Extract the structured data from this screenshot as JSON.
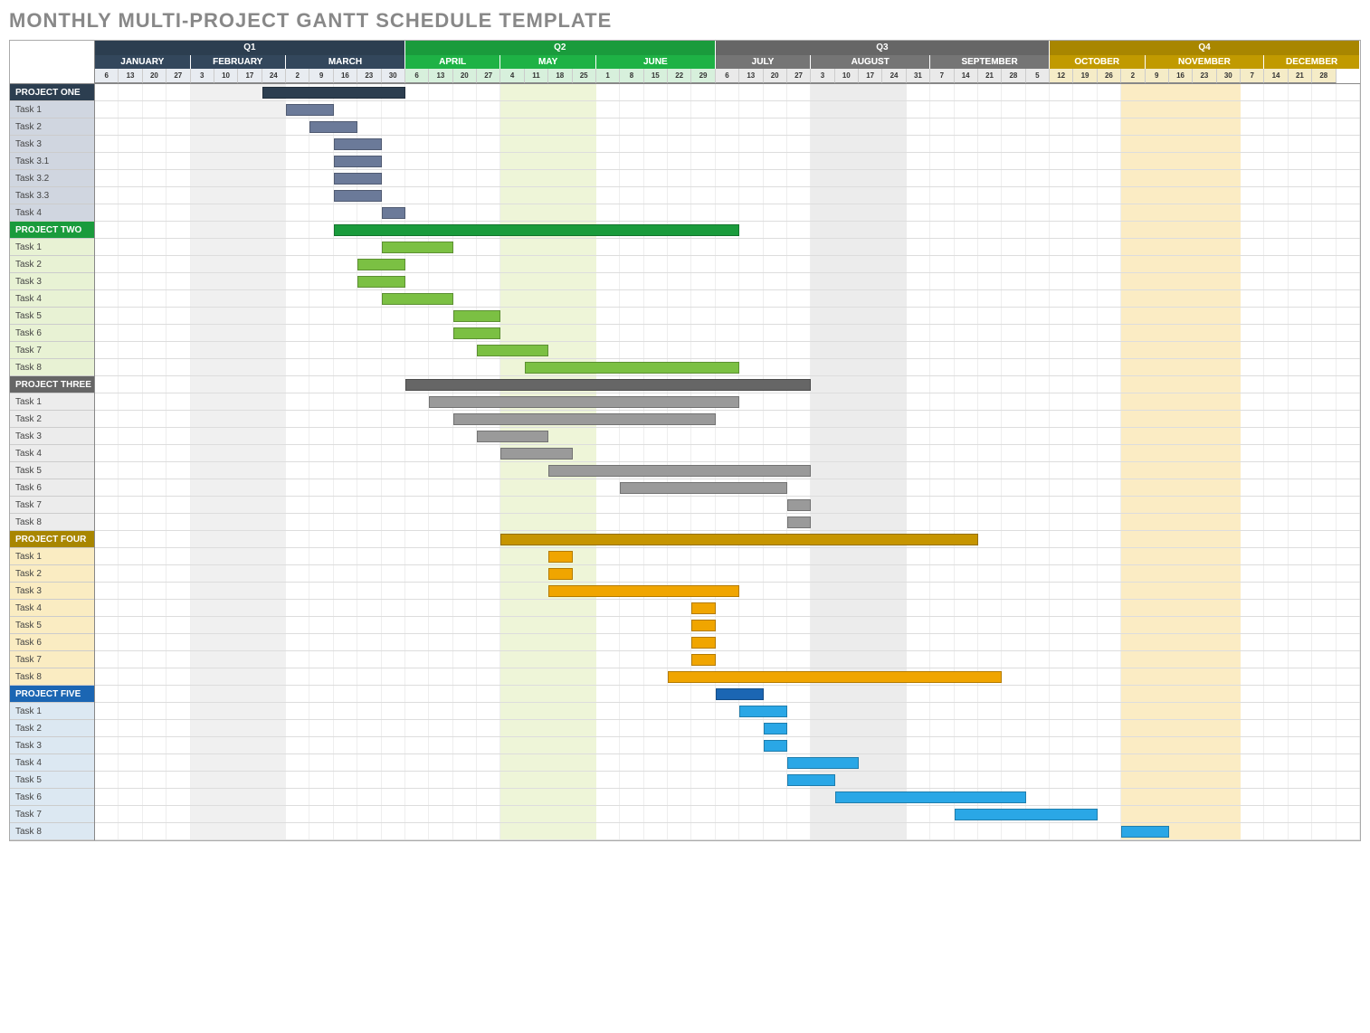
{
  "title": "MONTHLY MULTI-PROJECT GANTT SCHEDULE TEMPLATE",
  "chart_data": {
    "type": "gantt",
    "total_weeks": 53,
    "quarters": [
      {
        "label": "Q1",
        "weeks": 13,
        "bg": "#2c3e50"
      },
      {
        "label": "Q2",
        "weeks": 13,
        "bg": "#1a9b3c"
      },
      {
        "label": "Q3",
        "weeks": 14,
        "bg": "#666666"
      },
      {
        "label": "Q4",
        "weeks": 13,
        "bg": "#a88600"
      }
    ],
    "months": [
      {
        "label": "JANUARY",
        "weeks": 4,
        "bg": "#2c3e50"
      },
      {
        "label": "FEBRUARY",
        "weeks": 4,
        "bg": "#2c3e50"
      },
      {
        "label": "MARCH",
        "weeks": 5,
        "bg": "#2c3e50"
      },
      {
        "label": "APRIL",
        "weeks": 4,
        "bg": "#1a9b3c"
      },
      {
        "label": "MAY",
        "weeks": 4,
        "bg": "#1a9b3c"
      },
      {
        "label": "JUNE",
        "weeks": 5,
        "bg": "#1a9b3c"
      },
      {
        "label": "JULY",
        "weeks": 4,
        "bg": "#666666"
      },
      {
        "label": "AUGUST",
        "weeks": 5,
        "bg": "#666666"
      },
      {
        "label": "SEPTEMBER",
        "weeks": 5,
        "bg": "#666666"
      },
      {
        "label": "OCTOBER",
        "weeks": 4,
        "bg": "#a88600"
      },
      {
        "label": "NOVEMBER",
        "weeks": 5,
        "bg": "#a88600"
      },
      {
        "label": "DECEMBER",
        "weeks": 4,
        "bg": "#a88600"
      }
    ],
    "weeks": [
      6,
      13,
      20,
      27,
      3,
      10,
      17,
      24,
      2,
      9,
      16,
      23,
      30,
      6,
      13,
      20,
      27,
      4,
      11,
      18,
      25,
      1,
      8,
      15,
      22,
      29,
      6,
      13,
      20,
      27,
      3,
      10,
      17,
      24,
      31,
      7,
      14,
      21,
      28,
      5,
      12,
      19,
      26,
      2,
      9,
      16,
      23,
      30,
      7,
      14,
      21,
      28
    ],
    "months_header_bg": {
      "Q1": "#34495e",
      "Q2": "#22b24a",
      "Q3": "#777777",
      "Q4": "#bfa000"
    },
    "shaded_months": [
      1,
      6,
      7,
      10
    ],
    "shade_colors": {
      "1": "#f0f0f0",
      "6": "#f0f0f0",
      "7": "#f0f0f0",
      "10": "#f0f0f0"
    },
    "special_shades": [
      {
        "start": 17,
        "span": 4,
        "color": "#eef5d8"
      },
      {
        "start": 30,
        "span": 4,
        "color": "#ececec"
      },
      {
        "start": 43,
        "span": 5,
        "color": "#fbecc4"
      },
      {
        "start": 4,
        "span": 4,
        "color": "#f0f0f0"
      }
    ],
    "projects": [
      {
        "name": "PROJECT ONE",
        "header_bg": "#2c3e50",
        "header_fg": "#fff",
        "task_bg": "#d0d6e0",
        "bars": [
          {
            "row": "header",
            "start": 7,
            "span": 6,
            "color": "#2c3e50"
          }
        ],
        "tasks": [
          {
            "label": "Task 1",
            "start": 8,
            "span": 2,
            "color": "#6b7a99"
          },
          {
            "label": "Task 2",
            "start": 9,
            "span": 2,
            "color": "#6b7a99"
          },
          {
            "label": "Task 3",
            "start": 10,
            "span": 2,
            "color": "#6b7a99"
          },
          {
            "label": "Task 3.1",
            "start": 10,
            "span": 2,
            "color": "#6b7a99"
          },
          {
            "label": "Task 3.2",
            "start": 10,
            "span": 2,
            "color": "#6b7a99"
          },
          {
            "label": "Task 3.3",
            "start": 10,
            "span": 2,
            "color": "#6b7a99"
          },
          {
            "label": "Task 4",
            "start": 12,
            "span": 1,
            "color": "#6b7a99"
          }
        ]
      },
      {
        "name": "PROJECT TWO",
        "header_bg": "#1a9b3c",
        "header_fg": "#fff",
        "task_bg": "#e8f2d4",
        "bars": [
          {
            "row": "header",
            "start": 10,
            "span": 17,
            "color": "#1a9b3c"
          }
        ],
        "tasks": [
          {
            "label": "Task 1",
            "start": 12,
            "span": 3,
            "color": "#7bc043"
          },
          {
            "label": "Task 2",
            "start": 11,
            "span": 2,
            "color": "#7bc043"
          },
          {
            "label": "Task 3",
            "start": 11,
            "span": 2,
            "color": "#7bc043"
          },
          {
            "label": "Task 4",
            "start": 12,
            "span": 3,
            "color": "#7bc043"
          },
          {
            "label": "Task 5",
            "start": 15,
            "span": 2,
            "color": "#7bc043"
          },
          {
            "label": "Task 6",
            "start": 15,
            "span": 2,
            "color": "#7bc043"
          },
          {
            "label": "Task 7",
            "start": 16,
            "span": 3,
            "color": "#7bc043"
          },
          {
            "label": "Task 8",
            "start": 18,
            "span": 9,
            "color": "#7bc043"
          }
        ]
      },
      {
        "name": "PROJECT THREE",
        "header_bg": "#666666",
        "header_fg": "#fff",
        "task_bg": "#ececec",
        "bars": [
          {
            "row": "header",
            "start": 13,
            "span": 17,
            "color": "#666666"
          }
        ],
        "tasks": [
          {
            "label": "Task 1",
            "start": 14,
            "span": 13,
            "color": "#9a9a9a"
          },
          {
            "label": "Task 2",
            "start": 15,
            "span": 11,
            "color": "#9a9a9a"
          },
          {
            "label": "Task 3",
            "start": 16,
            "span": 3,
            "color": "#9a9a9a"
          },
          {
            "label": "Task 4",
            "start": 17,
            "span": 3,
            "color": "#9a9a9a"
          },
          {
            "label": "Task 5",
            "start": 19,
            "span": 11,
            "color": "#9a9a9a"
          },
          {
            "label": "Task 6",
            "start": 22,
            "span": 7,
            "color": "#9a9a9a"
          },
          {
            "label": "Task 7",
            "start": 29,
            "span": 1,
            "color": "#9a9a9a"
          },
          {
            "label": "Task 8",
            "start": 29,
            "span": 1,
            "color": "#9a9a9a"
          }
        ]
      },
      {
        "name": "PROJECT FOUR",
        "header_bg": "#a88600",
        "header_fg": "#fff",
        "task_bg": "#faecc2",
        "bars": [
          {
            "row": "header",
            "start": 17,
            "span": 20,
            "color": "#c69500"
          }
        ],
        "tasks": [
          {
            "label": "Task 1",
            "start": 19,
            "span": 1,
            "color": "#f0a500"
          },
          {
            "label": "Task 2",
            "start": 19,
            "span": 1,
            "color": "#f0a500"
          },
          {
            "label": "Task 3",
            "start": 19,
            "span": 8,
            "color": "#f0a500"
          },
          {
            "label": "Task 4",
            "start": 25,
            "span": 1,
            "color": "#f0a500"
          },
          {
            "label": "Task 5",
            "start": 25,
            "span": 1,
            "color": "#f0a500"
          },
          {
            "label": "Task 6",
            "start": 25,
            "span": 1,
            "color": "#f0a500"
          },
          {
            "label": "Task 7",
            "start": 25,
            "span": 1,
            "color": "#f0a500"
          },
          {
            "label": "Task 8",
            "start": 24,
            "span": 14,
            "color": "#f0a500"
          }
        ]
      },
      {
        "name": "PROJECT FIVE",
        "header_bg": "#1b66b3",
        "header_fg": "#fff",
        "task_bg": "#dce8f2",
        "bars": [
          {
            "row": "header",
            "start": 26,
            "span": 2,
            "color": "#1b66b3"
          }
        ],
        "tasks": [
          {
            "label": "Task 1",
            "start": 27,
            "span": 2,
            "color": "#2aa7e6"
          },
          {
            "label": "Task 2",
            "start": 28,
            "span": 1,
            "color": "#2aa7e6"
          },
          {
            "label": "Task 3",
            "start": 28,
            "span": 1,
            "color": "#2aa7e6"
          },
          {
            "label": "Task 4",
            "start": 29,
            "span": 3,
            "color": "#2aa7e6"
          },
          {
            "label": "Task 5",
            "start": 29,
            "span": 2,
            "color": "#2aa7e6"
          },
          {
            "label": "Task 6",
            "start": 31,
            "span": 8,
            "color": "#2aa7e6"
          },
          {
            "label": "Task 7",
            "start": 36,
            "span": 6,
            "color": "#2aa7e6"
          },
          {
            "label": "Task 8",
            "start": 43,
            "span": 2,
            "color": "#2aa7e6"
          }
        ]
      }
    ]
  }
}
